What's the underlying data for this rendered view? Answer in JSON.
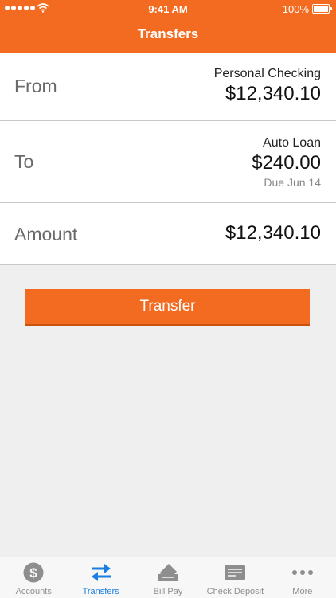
{
  "status": {
    "time": "9:41 AM",
    "battery": "100%"
  },
  "header": {
    "title": "Transfers"
  },
  "from": {
    "label": "From",
    "account": "Personal Checking",
    "amount": "$12,340.10"
  },
  "to": {
    "label": "To",
    "account": "Auto Loan",
    "amount": "$240.00",
    "due": "Due Jun 14"
  },
  "amount_row": {
    "label": "Amount",
    "value": "$12,340.10"
  },
  "transfer_button": {
    "label": "Transfer"
  },
  "colors": {
    "brand": "#f26b21",
    "active_tab": "#1a7fe0",
    "inactive_tab": "#8e8e8e"
  },
  "tabs": [
    {
      "label": "Accounts",
      "icon": "dollar-circle-icon",
      "active": false
    },
    {
      "label": "Transfers",
      "icon": "transfer-arrows-icon",
      "active": true
    },
    {
      "label": "Bill Pay",
      "icon": "bill-pay-icon",
      "active": false
    },
    {
      "label": "Check Deposit",
      "icon": "check-icon",
      "active": false
    },
    {
      "label": "More",
      "icon": "more-dots-icon",
      "active": false
    }
  ]
}
